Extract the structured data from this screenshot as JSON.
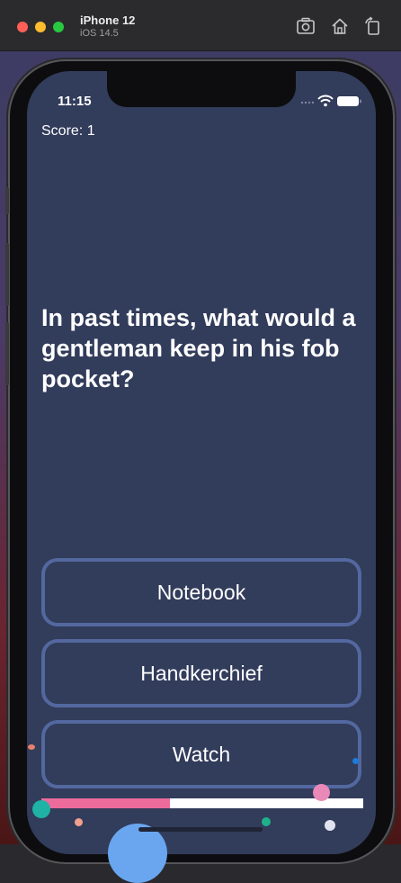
{
  "simulator": {
    "device_name": "iPhone 12",
    "os_version": "iOS 14.5",
    "toolbar_icons": [
      "screenshot-icon",
      "home-icon",
      "rotate-icon"
    ]
  },
  "status_bar": {
    "time": "11:15",
    "icons": [
      "signal-icon",
      "wifi-icon",
      "battery-icon"
    ]
  },
  "game": {
    "score_label": "Score: 1",
    "question": "In past times, what would a gentleman keep in his fob pocket?",
    "answers": [
      {
        "label": "Notebook"
      },
      {
        "label": "Handkerchief"
      },
      {
        "label": "Watch"
      }
    ],
    "progress_fraction": 0.4
  },
  "colors": {
    "background": "#323c5b",
    "button_border": "#53689f",
    "progress_fill": "#ec6b9b",
    "progress_track": "#ffffff"
  }
}
